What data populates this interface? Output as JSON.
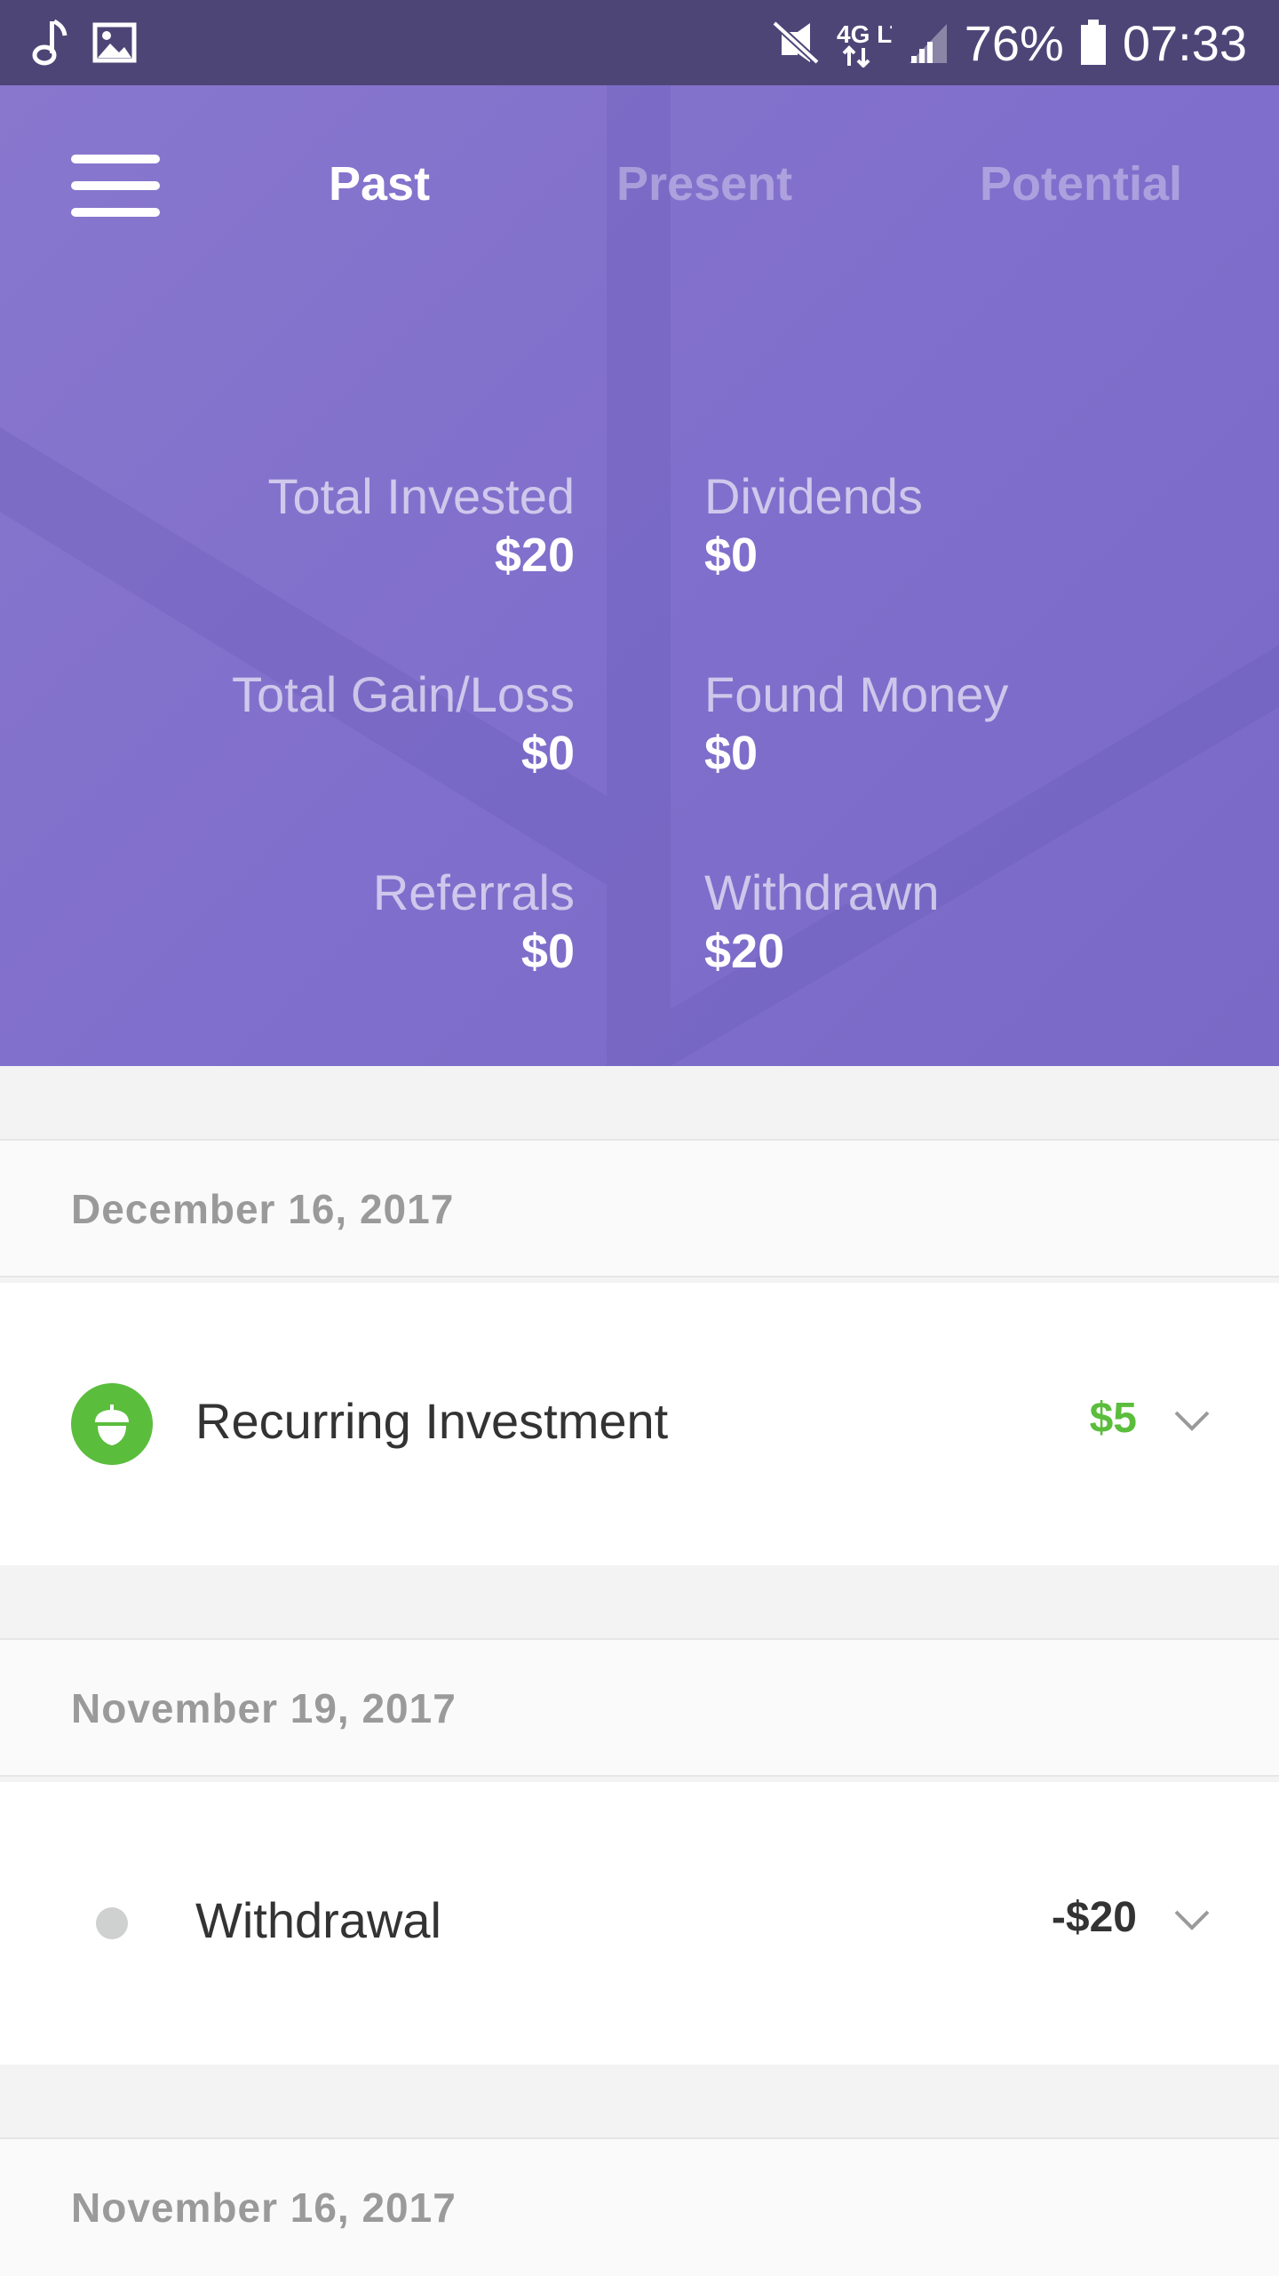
{
  "status_bar": {
    "battery": "76%",
    "time": "07:33",
    "network": "4G LTE",
    "icons": [
      "music-note-icon",
      "image-icon",
      "vibrate-mute-icon",
      "data-arrows-icon",
      "signal-icon",
      "battery-icon"
    ]
  },
  "colors": {
    "status_bar": "#4e4577",
    "hero": "#806fcc",
    "positive": "#5bbd3c",
    "negative": "#333333"
  },
  "nav": {
    "menu_icon": "hamburger-menu-icon",
    "tabs": [
      {
        "label": "Past",
        "active": true
      },
      {
        "label": "Present",
        "active": false
      },
      {
        "label": "Potential",
        "active": false
      }
    ]
  },
  "stats": {
    "total_invested": {
      "label": "Total Invested",
      "value": "$20"
    },
    "dividends": {
      "label": "Dividends",
      "value": "$0"
    },
    "total_gain_loss": {
      "label": "Total Gain/Loss",
      "value": "$0"
    },
    "found_money": {
      "label": "Found Money",
      "value": "$0"
    },
    "referrals": {
      "label": "Referrals",
      "value": "$0"
    },
    "withdrawn": {
      "label": "Withdrawn",
      "value": "$20"
    }
  },
  "history": [
    {
      "date": "December 16, 2017",
      "transactions": [
        {
          "label": "Recurring Investment",
          "amount": "$5",
          "icon": "acorn-icon",
          "type": "positive"
        }
      ]
    },
    {
      "date": "November 19, 2017",
      "transactions": [
        {
          "label": "Withdrawal",
          "amount": "-$20",
          "icon": "gray-dot-icon",
          "type": "negative"
        }
      ]
    },
    {
      "date": "November 16, 2017",
      "transactions": []
    }
  ]
}
